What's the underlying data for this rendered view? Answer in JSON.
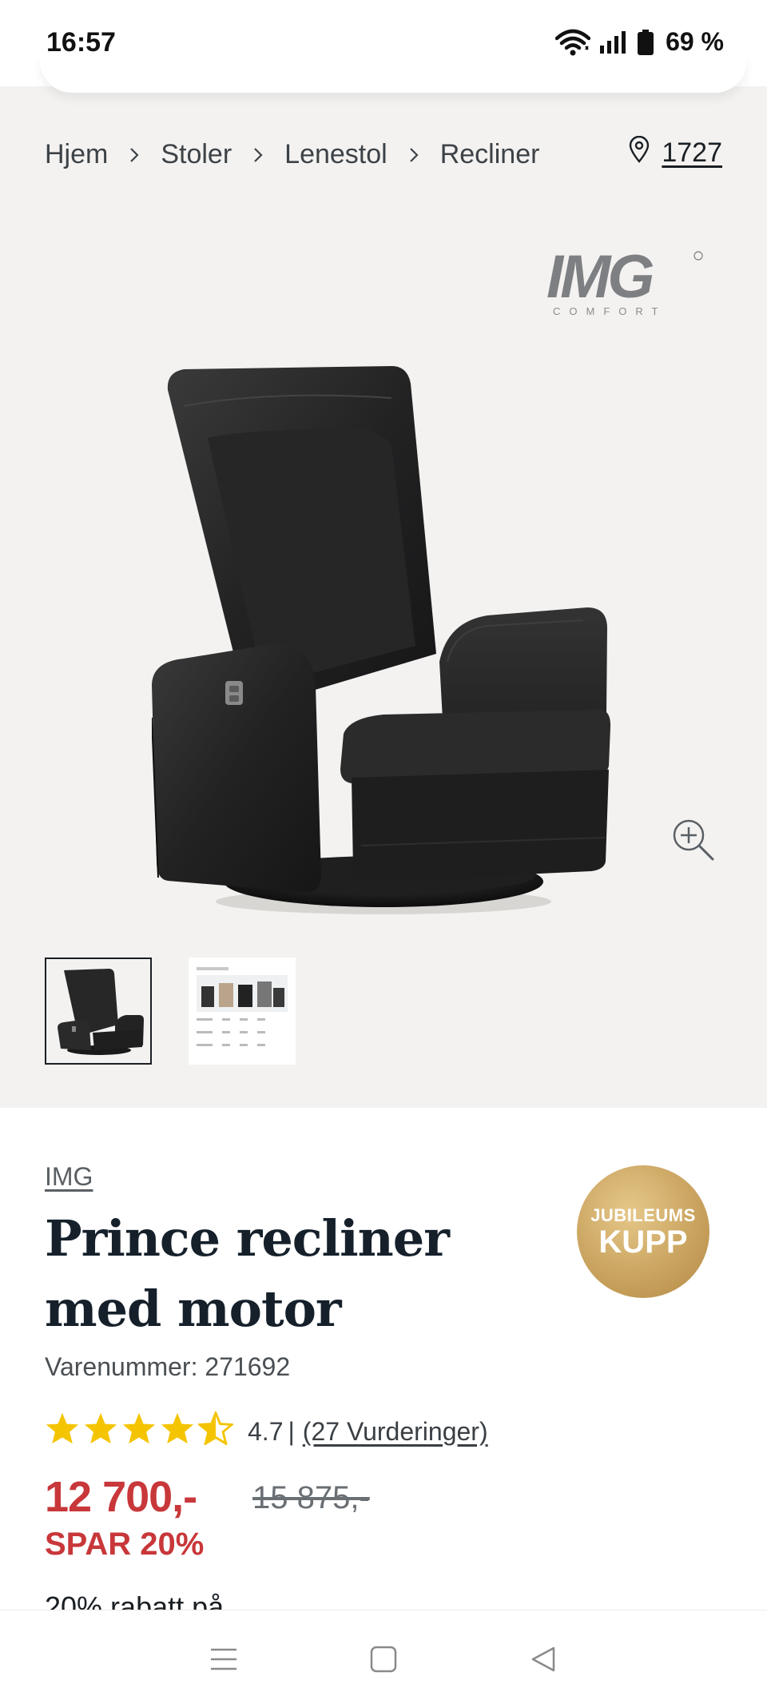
{
  "status_bar": {
    "time": "16:57",
    "battery": "69 %"
  },
  "breadcrumb": {
    "items": [
      "Hjem",
      "Stoler",
      "Lenestol",
      "Recliner"
    ]
  },
  "store": {
    "number": "1727"
  },
  "brand_logo": {
    "text": "IMG",
    "subtext": "COMFORT",
    "color": "#7d7f82"
  },
  "product": {
    "brand": "IMG",
    "title": "Prince recliner med motor",
    "sku": "Varenummer: 271692",
    "badge": {
      "line1": "JUBILEUMS",
      "line2": "KUPP",
      "color": "#c9a25d"
    },
    "rating": {
      "score": "4.7",
      "divider": "|",
      "reviews": "(27 Vurderinger)",
      "stars_value": 4.7,
      "star_color": "#f5c400"
    },
    "price": "12 700,-",
    "old_price": "15 875,-",
    "save": "SPAR 20%",
    "promo": "20% rabatt på",
    "price_color": "#c8373a"
  },
  "icons": [
    "wifi-icon",
    "signal-icon",
    "battery-icon",
    "location-pin-icon",
    "zoom-in-icon",
    "chevron-right-icon",
    "star-icon",
    "menu-icon",
    "home-square-icon",
    "back-triangle-icon"
  ]
}
